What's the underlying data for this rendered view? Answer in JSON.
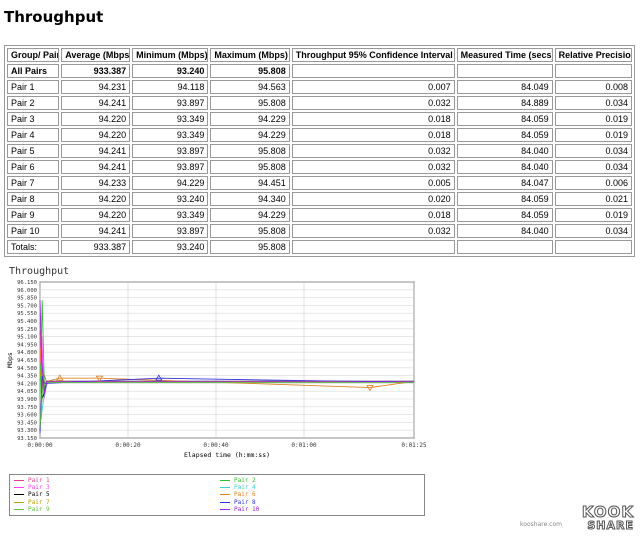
{
  "page": {
    "title": "Throughput"
  },
  "table": {
    "headers": [
      "Group/ Pair",
      "Average (Mbps)",
      "Minimum (Mbps)",
      "Maximum (Mbps)",
      "Throughput 95% Confidence Interval",
      "Measured Time (secs)",
      "Relative Precision"
    ],
    "rows": [
      [
        "All Pairs",
        "933.387",
        "93.240",
        "95.808",
        "",
        "",
        ""
      ],
      [
        "Pair 1",
        "94.231",
        "94.118",
        "94.563",
        "0.007",
        "84.049",
        "0.008"
      ],
      [
        "Pair 2",
        "94.241",
        "93.897",
        "95.808",
        "0.032",
        "84.889",
        "0.034"
      ],
      [
        "Pair 3",
        "94.220",
        "93.349",
        "94.229",
        "0.018",
        "84.059",
        "0.019"
      ],
      [
        "Pair 4",
        "94.220",
        "93.349",
        "94.229",
        "0.018",
        "84.059",
        "0.019"
      ],
      [
        "Pair 5",
        "94.241",
        "93.897",
        "95.808",
        "0.032",
        "84.040",
        "0.034"
      ],
      [
        "Pair 6",
        "94.241",
        "93.897",
        "95.808",
        "0.032",
        "84.040",
        "0.034"
      ],
      [
        "Pair 7",
        "94.233",
        "94.229",
        "94.451",
        "0.005",
        "84.047",
        "0.006"
      ],
      [
        "Pair 8",
        "94.220",
        "93.240",
        "94.340",
        "0.020",
        "84.059",
        "0.021"
      ],
      [
        "Pair 9",
        "94.220",
        "93.349",
        "94.229",
        "0.018",
        "84.059",
        "0.019"
      ],
      [
        "Pair 10",
        "94.241",
        "93.897",
        "95.808",
        "0.032",
        "84.040",
        "0.034"
      ],
      [
        "Totals:",
        "933.387",
        "93.240",
        "95.808",
        "",
        "",
        ""
      ]
    ]
  },
  "chart_data": {
    "type": "line",
    "title": "Throughput",
    "xlabel": "Elapsed time (h:mm:ss)",
    "ylabel": "Mbps",
    "xlim": [
      0,
      85
    ],
    "ylim": [
      93.15,
      96.15
    ],
    "x_ticks": [
      {
        "value": 0,
        "label": "0:00:00"
      },
      {
        "value": 20,
        "label": "0:00:20"
      },
      {
        "value": 40,
        "label": "0:00:40"
      },
      {
        "value": 60,
        "label": "0:01:00"
      },
      {
        "value": 85,
        "label": "0:01:25"
      }
    ],
    "y_ticks": [
      "93.150",
      "93.300",
      "93.450",
      "93.600",
      "93.750",
      "93.900",
      "94.050",
      "94.200",
      "94.350",
      "94.500",
      "94.650",
      "94.800",
      "94.950",
      "95.100",
      "95.250",
      "95.400",
      "95.550",
      "95.700",
      "95.850",
      "96.000",
      "96.150"
    ],
    "grid": true,
    "legend_position": "bottom",
    "series": [
      {
        "name": "Pair 1",
        "color": "#e0408a",
        "points": [
          [
            0,
            95.2
          ],
          [
            0.4,
            94.0
          ],
          [
            0.8,
            94.4
          ],
          [
            1.5,
            94.23
          ],
          [
            85,
            94.23
          ]
        ]
      },
      {
        "name": "Pair 2",
        "color": "#30c030",
        "points": [
          [
            0,
            93.9
          ],
          [
            0.5,
            95.8
          ],
          [
            1.0,
            94.1
          ],
          [
            1.6,
            94.24
          ],
          [
            85,
            94.24
          ]
        ]
      },
      {
        "name": "Pair 3",
        "color": "#ff40ff",
        "points": [
          [
            0,
            94.6
          ],
          [
            0.4,
            95.1
          ],
          [
            0.9,
            93.9
          ],
          [
            1.6,
            94.22
          ],
          [
            85,
            94.22
          ]
        ]
      },
      {
        "name": "Pair 4",
        "color": "#40d0d0",
        "points": [
          [
            0,
            93.4
          ],
          [
            0.5,
            93.7
          ],
          [
            1.0,
            94.0
          ],
          [
            1.7,
            94.22
          ],
          [
            85,
            94.22
          ]
        ]
      },
      {
        "name": "Pair 5",
        "color": "#000000",
        "points": [
          [
            0,
            93.3
          ],
          [
            0.4,
            93.9
          ],
          [
            0.9,
            94.0
          ],
          [
            1.6,
            94.24
          ],
          [
            85,
            94.24
          ]
        ]
      },
      {
        "name": "Pair 6",
        "color": "#e08020",
        "points": [
          [
            0,
            94.9
          ],
          [
            0.5,
            94.3
          ],
          [
            1.0,
            94.2
          ],
          [
            1.6,
            94.24
          ],
          [
            4.5,
            94.3
          ],
          [
            13.5,
            94.3
          ],
          [
            75,
            94.12
          ],
          [
            85,
            94.24
          ]
        ]
      },
      {
        "name": "Pair 7",
        "color": "#c0a000",
        "points": [
          [
            0,
            94.45
          ],
          [
            0.5,
            94.23
          ],
          [
            85,
            94.23
          ]
        ]
      },
      {
        "name": "Pair 8",
        "color": "#3030e0",
        "points": [
          [
            0,
            93.24
          ],
          [
            0.5,
            94.34
          ],
          [
            1.0,
            94.2
          ],
          [
            27,
            94.3
          ],
          [
            85,
            94.22
          ]
        ]
      },
      {
        "name": "Pair 9",
        "color": "#60c040",
        "points": [
          [
            0,
            93.35
          ],
          [
            0.6,
            94.1
          ],
          [
            1.2,
            94.22
          ],
          [
            85,
            94.22
          ]
        ]
      },
      {
        "name": "Pair 10",
        "color": "#a020e0",
        "points": [
          [
            0,
            95.8
          ],
          [
            0.4,
            94.6
          ],
          [
            1.0,
            94.0
          ],
          [
            1.6,
            94.24
          ],
          [
            85,
            94.24
          ]
        ]
      }
    ]
  },
  "watermark": {
    "url": "kooshare.com",
    "logo_top": "KOOK",
    "logo_bottom": "SHARE"
  }
}
